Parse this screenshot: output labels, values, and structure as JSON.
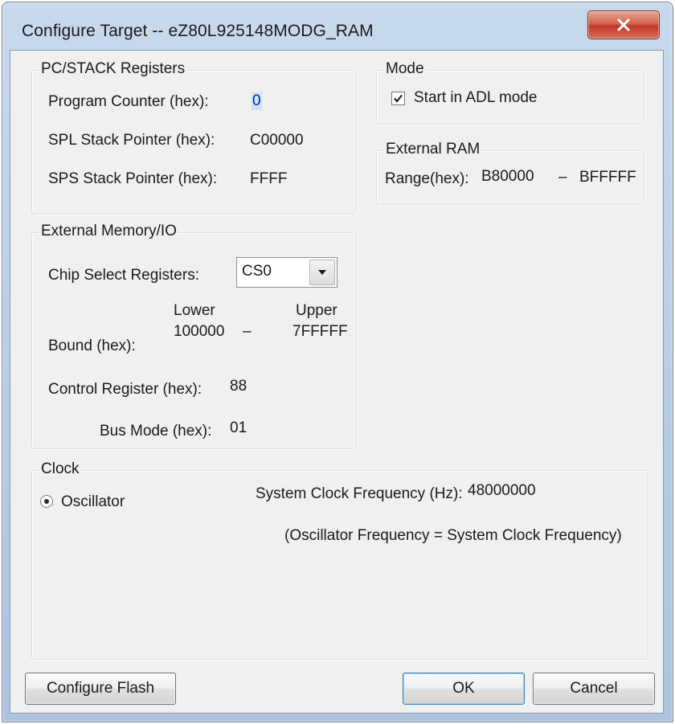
{
  "window": {
    "title": "Configure Target -- eZ80L925148MODG_RAM",
    "close_icon": "close-x-icon"
  },
  "pc_stack": {
    "legend": "PC/STACK Registers",
    "program_counter_label": "Program Counter (hex):",
    "program_counter_value": "0",
    "spl_label": "SPL Stack Pointer (hex):",
    "spl_value": "C00000",
    "sps_label": "SPS Stack Pointer (hex):",
    "sps_value": "FFFF"
  },
  "mode": {
    "legend": "Mode",
    "adl_label": "Start in ADL mode",
    "adl_checked": true
  },
  "external_ram": {
    "legend": "External RAM",
    "range_label": "Range(hex):",
    "range_lower": "B80000",
    "range_sep": "–",
    "range_upper": "BFFFFF"
  },
  "external_memory": {
    "legend": "External Memory/IO",
    "chip_select_label": "Chip Select Registers:",
    "chip_select_value": "CS0",
    "lower_header": "Lower",
    "upper_header": "Upper",
    "bound_label": "Bound (hex):",
    "bound_lower": "100000",
    "bound_sep": "–",
    "bound_upper": "7FFFFF",
    "control_label": "Control Register (hex):",
    "control_value": "88",
    "bus_mode_label": "Bus Mode (hex):",
    "bus_mode_value": "01"
  },
  "clock": {
    "legend": "Clock",
    "oscillator_label": "Oscillator",
    "oscillator_selected": true,
    "sys_freq_label": "System Clock Frequency (Hz):",
    "sys_freq_value": "48000000",
    "note": "(Oscillator Frequency = System Clock Frequency)"
  },
  "buttons": {
    "configure_flash": "Configure Flash",
    "ok": "OK",
    "cancel": "Cancel"
  }
}
